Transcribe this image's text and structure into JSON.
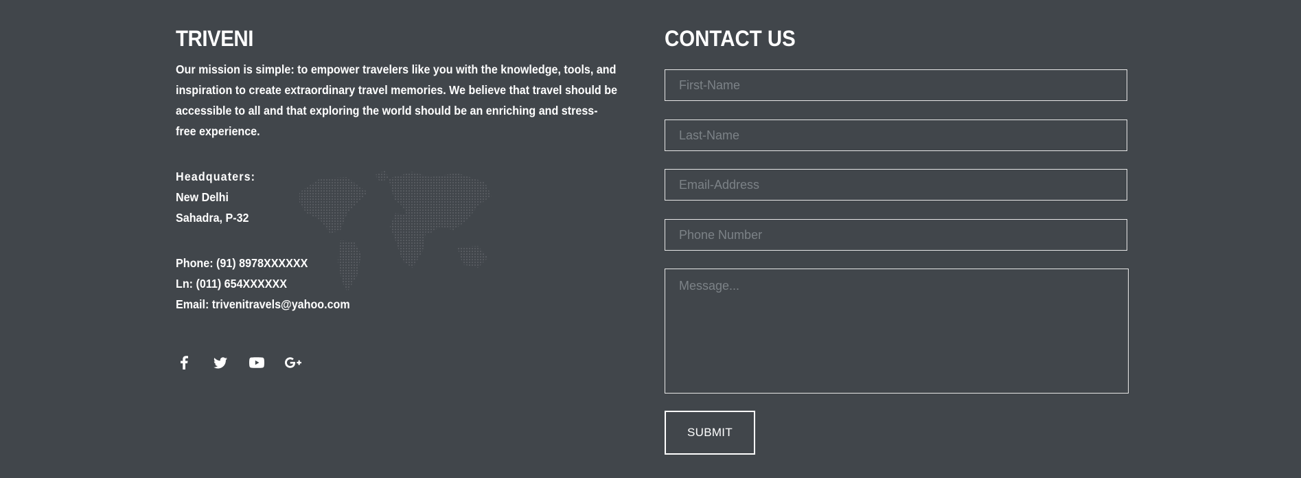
{
  "about": {
    "brand": "TRIVENI",
    "mission": "Our mission is simple: to empower travelers like you with the knowledge, tools, and inspiration to create extraordinary travel memories. We believe that travel should be accessible to all and that exploring the world should be an enriching and stress-free experience.",
    "hq_label": "Headquaters:",
    "hq_city": "New Delhi",
    "hq_address": "Sahadra, P-32",
    "phone": "Phone: (91) 8978XXXXXX",
    "landline": "Ln: (011) 654XXXXXX",
    "email": "Email: trivenitravels@yahoo.com",
    "social": [
      {
        "name": "facebook-icon"
      },
      {
        "name": "twitter-icon"
      },
      {
        "name": "youtube-icon"
      },
      {
        "name": "google-plus-icon"
      }
    ]
  },
  "contact": {
    "title": "CONTACT US",
    "first_name_placeholder": "First-Name",
    "last_name_placeholder": "Last-Name",
    "email_placeholder": "Email-Address",
    "phone_placeholder": "Phone Number",
    "message_placeholder": "Message...",
    "submit_label": "SUBMIT"
  },
  "colors": {
    "background": "#41464b",
    "text": "#ffffff",
    "placeholder": "#7c8287",
    "border": "#e8e8e8"
  }
}
